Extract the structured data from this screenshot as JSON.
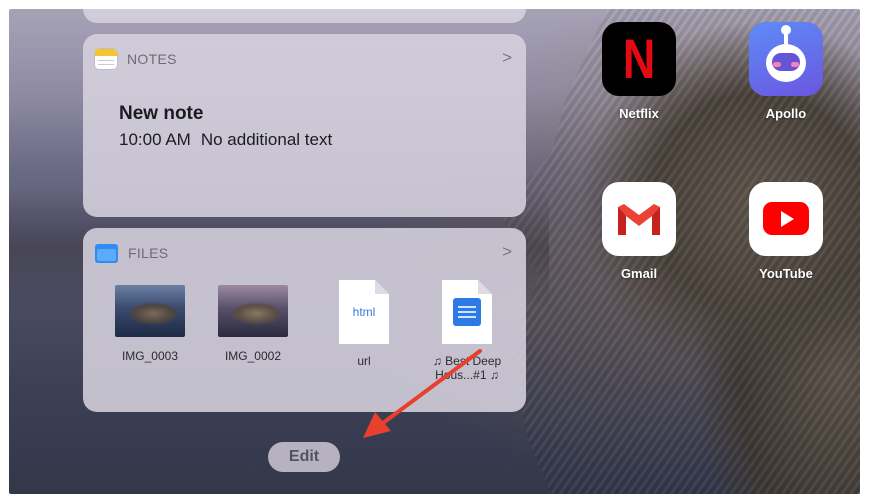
{
  "notes_widget": {
    "header_label": "NOTES",
    "note_title": "New note",
    "note_time": "10:00 AM",
    "note_preview": "No additional text"
  },
  "files_widget": {
    "header_label": "FILES",
    "files": [
      {
        "name": "IMG_0003",
        "kind": "image"
      },
      {
        "name": "IMG_0002",
        "kind": "image"
      },
      {
        "name": "url",
        "kind": "doc",
        "ext": "html"
      },
      {
        "name": "♫ Best Deep Hous...#1 ♫",
        "kind": "audio"
      }
    ]
  },
  "edit_button": {
    "label": "Edit"
  },
  "apps": [
    {
      "name": "Netflix",
      "icon": "netflix-icon"
    },
    {
      "name": "Apollo",
      "icon": "apollo-icon"
    },
    {
      "name": "Gmail",
      "icon": "gmail-icon"
    },
    {
      "name": "YouTube",
      "icon": "youtube-icon"
    }
  ],
  "colors": {
    "annotation_arrow": "#e8402c",
    "widget_bg": "#d6d2de",
    "files_folder": "#2e8df2",
    "notes_yellow": "#f5c531"
  }
}
